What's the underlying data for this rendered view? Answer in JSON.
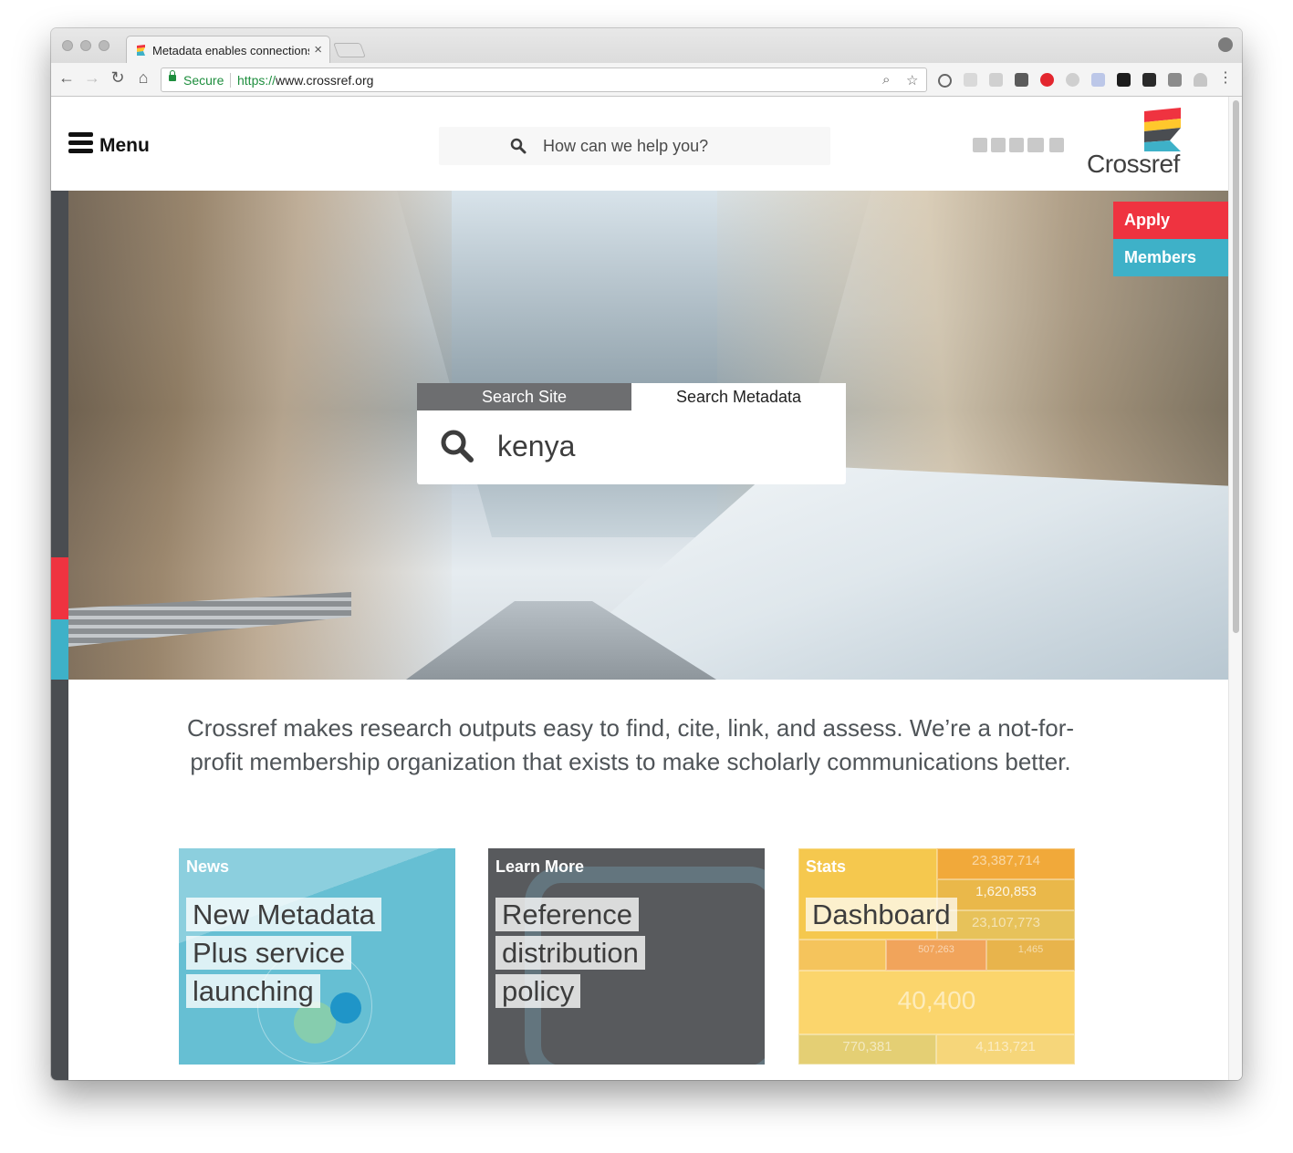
{
  "browser": {
    "tab_title": "Metadata enables connections",
    "tab_close": "×",
    "secure_label": "Secure",
    "url_scheme": "https://",
    "url_rest": "www.crossref.org",
    "nav_back": "←",
    "nav_forward": "→",
    "nav_reload": "↻",
    "nav_home": "⌂",
    "zoom_icon": "⌕",
    "star_icon": "☆",
    "menu_icon": "⋮"
  },
  "header": {
    "menu_label": "Menu",
    "site_search_placeholder": "How can we help you?",
    "logo_text": "Crossref"
  },
  "side_ctas": {
    "apply": "Apply",
    "members": "Members"
  },
  "hero_search": {
    "tab_site": "Search Site",
    "tab_metadata": "Search Metadata",
    "query": "kenya"
  },
  "intro": "Crossref makes research outputs easy to find, cite, link, and assess. We’re a not-for-profit membership organization that exists to make scholarly communications better.",
  "cards": [
    {
      "label": "News",
      "title_lines": [
        "New Metadata",
        "Plus service",
        "launching"
      ]
    },
    {
      "label": "Learn More",
      "title_lines": [
        "Reference",
        "distribution",
        "policy"
      ]
    },
    {
      "label": "Stats",
      "title_lines": [
        "Dashboard"
      ]
    }
  ],
  "stats_numbers": [
    "23,387,714",
    "1,620,853",
    "23,107,773",
    "507,263",
    "1,465",
    "40,400",
    "770,381",
    "4,113,721"
  ],
  "colors": {
    "red": "#ef3340",
    "teal": "#3eb1c8",
    "dark": "#4a4d51",
    "yellow": "#ffc72c"
  }
}
